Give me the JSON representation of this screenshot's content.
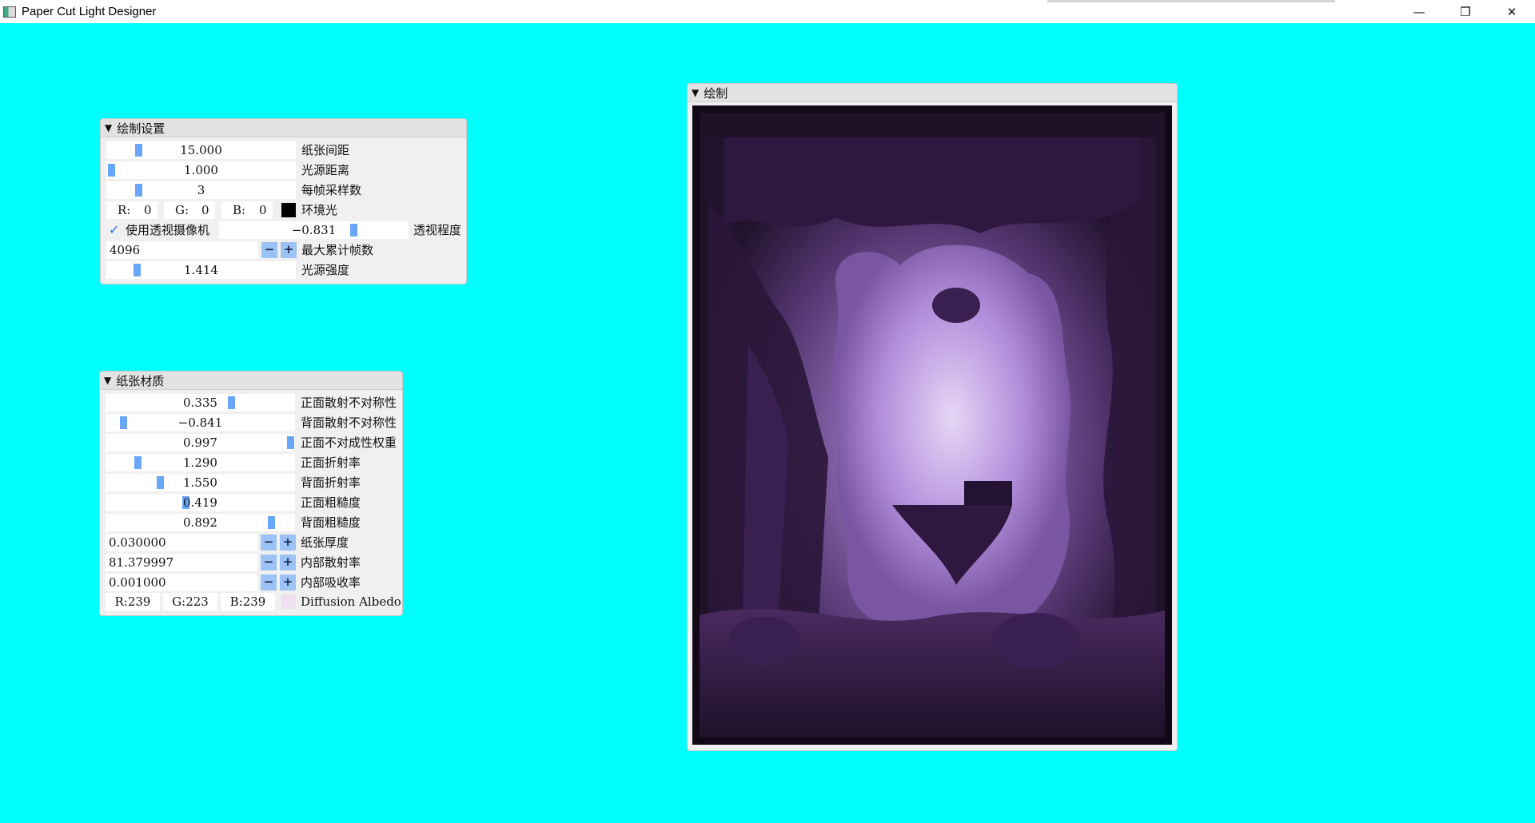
{
  "window": {
    "title": "Paper Cut Light Designer",
    "icon": "app-icon",
    "controls": {
      "minimize": "—",
      "restore": "❐",
      "close": "✕"
    }
  },
  "colors": {
    "background": "#00ffff",
    "slider_grab": "#6aa6f8",
    "step_button": "#9cc3f5"
  },
  "render_settings": {
    "title": "绘制设置",
    "paper_spacing": {
      "value": "15.000",
      "label": "纸张间距",
      "fraction": 0.16
    },
    "light_distance": {
      "value": "1.000",
      "label": "光源距离",
      "fraction": 0.01
    },
    "samples_per_frame": {
      "value": "3",
      "label": "每帧采样数",
      "fraction": 0.16
    },
    "ambient": {
      "r_label": "R:",
      "r": "0",
      "g_label": "G:",
      "g": "0",
      "b_label": "B:",
      "b": "0",
      "label": "环境光",
      "color": "#000000"
    },
    "perspective": {
      "checkbox_label": "使用透视摄像机",
      "checked": true,
      "value": "−0.831",
      "label": "透视程度",
      "fraction": 0.72
    },
    "max_frames": {
      "value": "4096",
      "minus": "−",
      "plus": "+",
      "label": "最大累计帧数"
    },
    "light_intensity": {
      "value": "1.414",
      "label": "光源强度",
      "fraction": 0.15
    }
  },
  "paper_material": {
    "title": "纸张材质",
    "sliders": [
      {
        "value": "0.335",
        "label": "正面散射不对称性",
        "fraction": 0.67
      },
      {
        "value": "−0.841",
        "label": "背面散射不对称性",
        "fraction": 0.08
      },
      {
        "value": "0.997",
        "label": "正面不对成性权重",
        "fraction": 0.995
      },
      {
        "value": "1.290",
        "label": "正面折射率",
        "fraction": 0.16
      },
      {
        "value": "1.550",
        "label": "背面折射率",
        "fraction": 0.28
      },
      {
        "value": "0.419",
        "label": "正面粗糙度",
        "fraction": 0.42
      },
      {
        "value": "0.892",
        "label": "背面粗糙度",
        "fraction": 0.89
      }
    ],
    "steppers": [
      {
        "value": "0.030000",
        "minus": "−",
        "plus": "+",
        "label": "纸张厚度"
      },
      {
        "value": "81.379997",
        "minus": "−",
        "plus": "+",
        "label": "内部散射率"
      },
      {
        "value": "0.001000",
        "minus": "−",
        "plus": "+",
        "label": "内部吸收率"
      }
    ],
    "albedo": {
      "r": "R:239",
      "g": "G:223",
      "b": "B:239",
      "label": "Diffusion  Albedo",
      "color": "#efdfef"
    }
  },
  "render_view": {
    "title": "绘制"
  }
}
